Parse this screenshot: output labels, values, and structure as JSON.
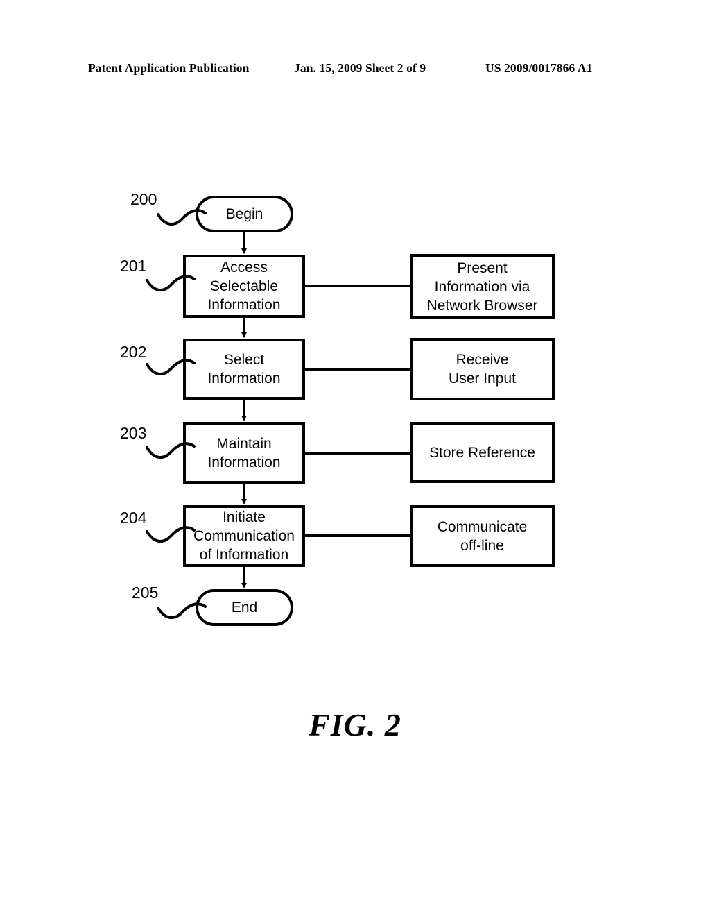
{
  "header": {
    "publication": "Patent Application Publication",
    "date_sheet": "Jan. 15, 2009  Sheet 2 of 9",
    "patent_number": "US 2009/0017866 A1"
  },
  "figure": {
    "caption": "FIG. 2",
    "line_color": "#000000",
    "fill_color": "#ffffff"
  },
  "flow": {
    "nodes": [
      {
        "id": "begin",
        "ref": "200",
        "shape": "terminator",
        "label": "Begin",
        "lines": [
          "Begin"
        ]
      },
      {
        "id": "access-selectable-information",
        "ref": "201",
        "shape": "process",
        "label": "Access Selectable Information",
        "lines": [
          "Access",
          "Selectable",
          "Information"
        ]
      },
      {
        "id": "select-information",
        "ref": "202",
        "shape": "process",
        "label": "Select Information",
        "lines": [
          "Select",
          "Information"
        ]
      },
      {
        "id": "maintain-information",
        "ref": "203",
        "shape": "process",
        "label": "Maintain Information",
        "lines": [
          "Maintain",
          "Information"
        ]
      },
      {
        "id": "initiate-communication-of-information",
        "ref": "204",
        "shape": "process",
        "label": "Initiate Communication of Information",
        "lines": [
          "Initiate",
          "Communication",
          "of Information"
        ]
      },
      {
        "id": "end",
        "ref": "205",
        "shape": "terminator",
        "label": "End",
        "lines": [
          "End"
        ]
      }
    ],
    "side_nodes": [
      {
        "id": "present-information-via-network-browser",
        "shape": "process",
        "label": "Present Information via Network Browser",
        "lines": [
          "Present",
          "Information via",
          "Network Browser"
        ],
        "linked_to": "access-selectable-information"
      },
      {
        "id": "receive-user-input",
        "shape": "process",
        "label": "Receive User Input",
        "lines": [
          "Receive",
          "User Input"
        ],
        "linked_to": "select-information"
      },
      {
        "id": "store-reference",
        "shape": "process",
        "label": "Store Reference",
        "lines": [
          "Store Reference"
        ],
        "linked_to": "maintain-information"
      },
      {
        "id": "communicate-off-line",
        "shape": "process",
        "label": "Communicate off-line",
        "lines": [
          "Communicate",
          "off-line"
        ],
        "linked_to": "initiate-communication-of-information"
      }
    ],
    "connectors": [
      {
        "from": "begin",
        "to": "access-selectable-information",
        "type": "arrow-down"
      },
      {
        "from": "access-selectable-information",
        "to": "select-information",
        "type": "arrow-down"
      },
      {
        "from": "select-information",
        "to": "maintain-information",
        "type": "arrow-down"
      },
      {
        "from": "maintain-information",
        "to": "initiate-communication-of-information",
        "type": "arrow-down"
      },
      {
        "from": "initiate-communication-of-information",
        "to": "end",
        "type": "arrow-down"
      },
      {
        "from": "access-selectable-information",
        "to": "present-information-via-network-browser",
        "type": "line-right"
      },
      {
        "from": "select-information",
        "to": "receive-user-input",
        "type": "line-right"
      },
      {
        "from": "maintain-information",
        "to": "store-reference",
        "type": "line-right"
      },
      {
        "from": "initiate-communication-of-information",
        "to": "communicate-off-line",
        "type": "line-right"
      }
    ]
  }
}
